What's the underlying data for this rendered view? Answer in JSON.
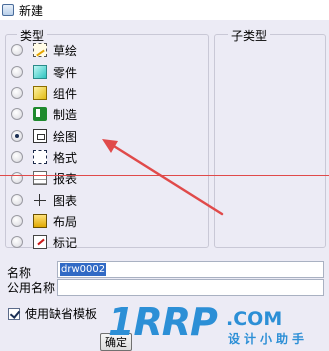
{
  "window": {
    "title": "新建"
  },
  "type_group": {
    "label": "类型",
    "items": [
      {
        "label": "草绘",
        "icon": "sketch-icon",
        "checked": false
      },
      {
        "label": "零件",
        "icon": "part-icon",
        "checked": false
      },
      {
        "label": "组件",
        "icon": "assembly-icon",
        "checked": false
      },
      {
        "label": "制造",
        "icon": "manufacturing-icon",
        "checked": false
      },
      {
        "label": "绘图",
        "icon": "drawing-icon",
        "checked": true
      },
      {
        "label": "格式",
        "icon": "format-icon",
        "checked": false
      },
      {
        "label": "报表",
        "icon": "report-icon",
        "checked": false
      },
      {
        "label": "图表",
        "icon": "diagram-icon",
        "checked": false
      },
      {
        "label": "布局",
        "icon": "layout-icon",
        "checked": false
      },
      {
        "label": "标记",
        "icon": "markup-icon",
        "checked": false
      }
    ]
  },
  "subtype_group": {
    "label": "子类型"
  },
  "name_field": {
    "label": "名称",
    "value": "drw0002"
  },
  "common_name_field": {
    "label": "公用名称",
    "value": ""
  },
  "use_default_template": {
    "label": "使用缺省模板",
    "checked": true
  },
  "buttons": {
    "ok": "确定"
  },
  "watermark": {
    "logo": "1RRP",
    "domain": ".COM",
    "tagline": "设计小助手"
  },
  "colors": {
    "selection": "#316ac5",
    "annotation_red": "#e04a4a",
    "watermark_blue": "#2c8fd6"
  }
}
